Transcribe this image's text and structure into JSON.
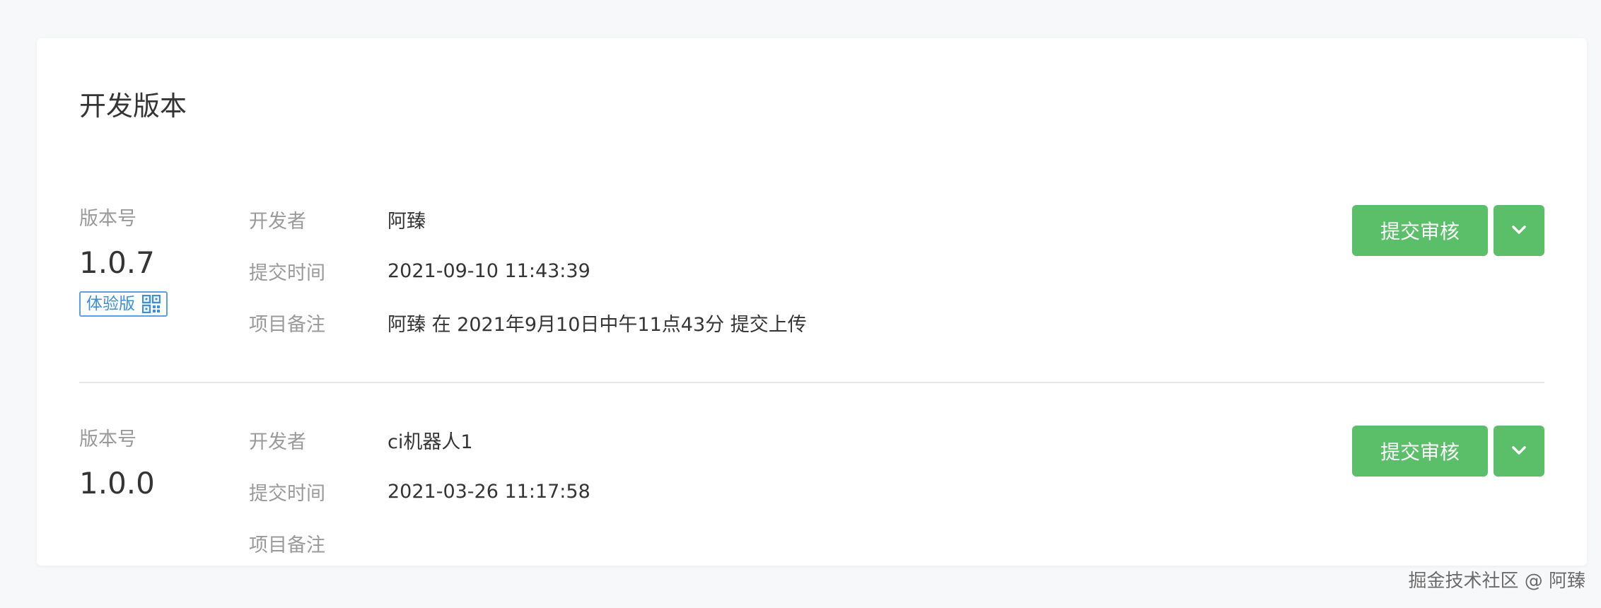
{
  "card": {
    "title": "开发版本"
  },
  "versions": [
    {
      "version_label": "版本号",
      "version_number": "1.0.7",
      "tag": {
        "label": "体验版",
        "icon": "qrcode-icon",
        "color": "#3c8ee0"
      },
      "developer_label": "开发者",
      "developer": "阿臻",
      "submit_time_label": "提交时间",
      "submit_time": "2021-09-10 11:43:39",
      "remark_label": "项目备注",
      "remark": "阿臻 在 2021年9月10日中午11点43分 提交上传",
      "submit_button": "提交审核",
      "more_icon": "chevron-down-icon"
    },
    {
      "version_label": "版本号",
      "version_number": "1.0.0",
      "developer_label": "开发者",
      "developer": "ci机器人1",
      "submit_time_label": "提交时间",
      "submit_time": "2021-03-26 11:17:58",
      "remark_label": "项目备注",
      "remark": "",
      "submit_button": "提交审核",
      "more_icon": "chevron-down-icon"
    }
  ],
  "watermark": "掘金技术社区 @ 阿臻",
  "colors": {
    "primary_button": "#5bbf6a",
    "tag_blue": "#3c8ee0",
    "label_gray": "#9a9a9a",
    "text": "#353535",
    "background": "#f7f8fa"
  }
}
